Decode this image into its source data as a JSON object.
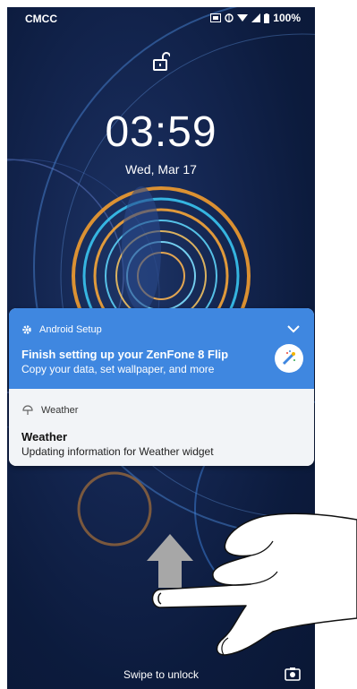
{
  "status_bar": {
    "carrier": "CMCC",
    "battery": "100%"
  },
  "lock_screen": {
    "time": "03:59",
    "date": "Wed, Mar 17",
    "swipe_hint": "Swipe to unlock"
  },
  "notifications": [
    {
      "app": "Android Setup",
      "title": "Finish setting up your ZenFone 8 Flip",
      "text": "Copy your data, set wallpaper, and more"
    },
    {
      "app": "Weather",
      "title": "Weather",
      "text": "Updating information for Weather widget"
    }
  ],
  "colors": {
    "setup_bg": "#3f87e0",
    "card_bg": "#f2f4f7"
  }
}
